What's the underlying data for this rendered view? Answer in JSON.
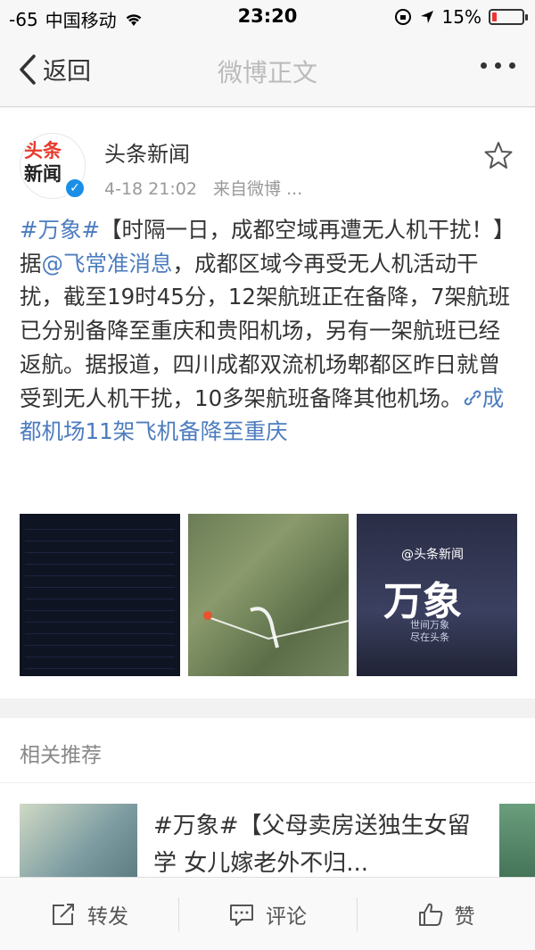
{
  "status_bar": {
    "signal": "-65",
    "carrier": "中国移动",
    "time": "23:20",
    "battery": "15%",
    "battery_level": 0.15
  },
  "nav": {
    "back_label": "返回",
    "title": "微博正文"
  },
  "post": {
    "avatar_text_line1": "头条",
    "avatar_text_line2": "新闻",
    "author": "头条新闻",
    "time": "4-18 21:02",
    "source": "来自微博 ...",
    "content": {
      "hashtag": "#万象#",
      "part1": "【时隔一日，成都空域再遭无人机干扰！】据",
      "mention": "@飞常准消息",
      "part2": "，成都区域今再受无人机活动干扰，截至19时45分，12架航班正在备降，7架航班已分别备降至重庆和贵阳机场，另有一架航班已经返航。据报道，四川成都双流机场郫都区昨日就曾受到无人机干扰，10多架航班备降其他机场。",
      "link": "成都机场11架飞机备降至重庆"
    },
    "image3": {
      "at": "@头条新闻",
      "title": "万象",
      "sub1": "世间万象",
      "sub2": "尽在头条"
    }
  },
  "related": {
    "title": "相关推荐",
    "item_text": "#万象#【父母卖房送独生女留学 女儿嫁老外不归..."
  },
  "actions": {
    "repost": "转发",
    "comment": "评论",
    "like": "赞"
  },
  "colors": {
    "link": "#4c7cbf",
    "battery_low": "#e33"
  }
}
